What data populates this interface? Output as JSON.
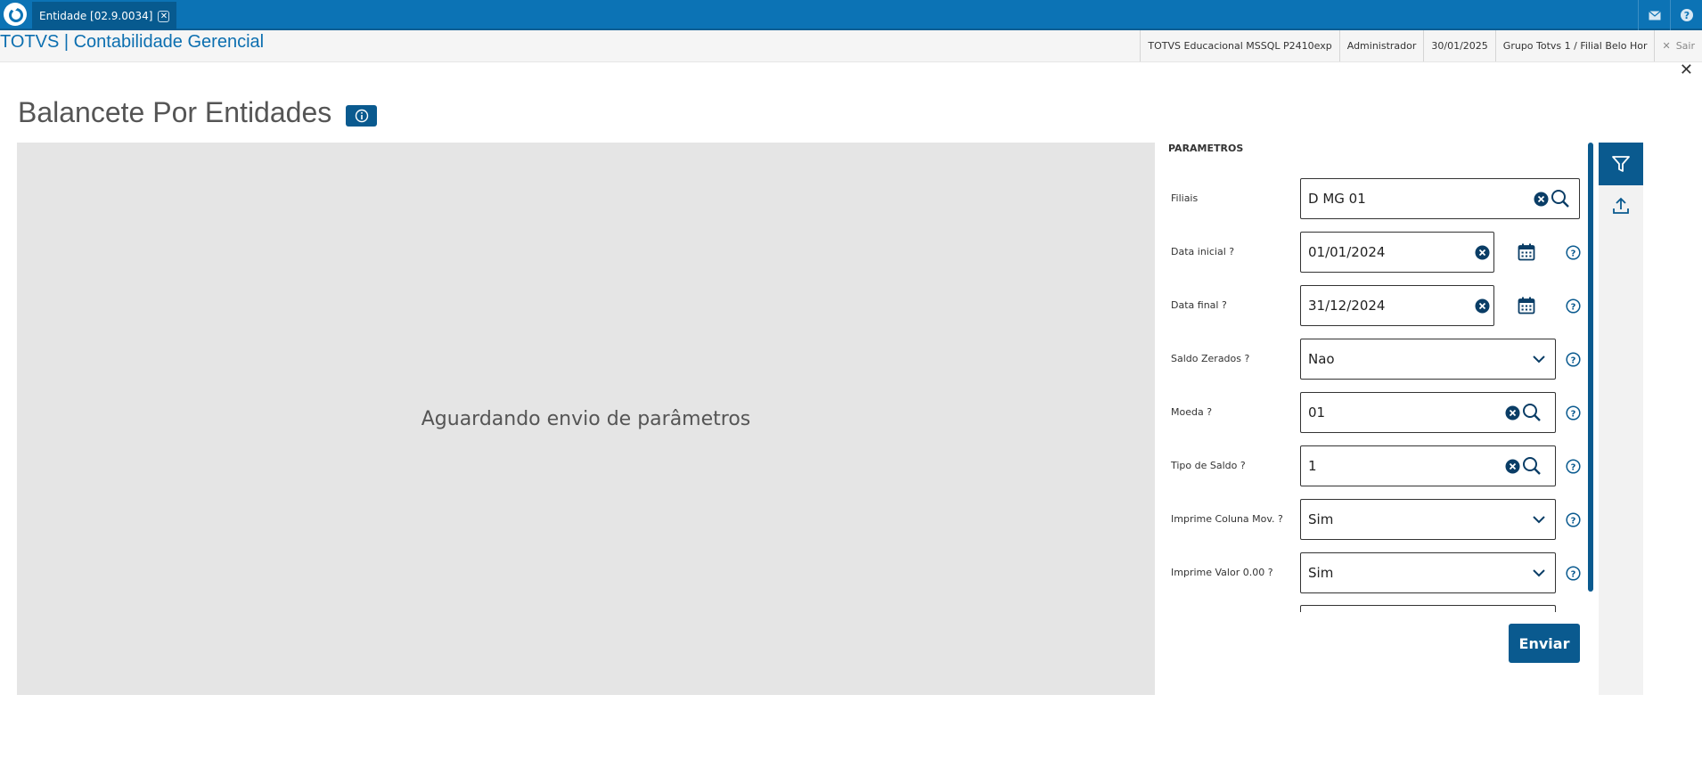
{
  "topbar": {
    "tab_label": "Entidade [02.9.0034]",
    "icons": [
      "mail-icon",
      "help-icon"
    ]
  },
  "header": {
    "app_title": "TOTVS | Contabilidade Gerencial",
    "environment": "TOTVS Educacional MSSQL P2410exp",
    "user": "Administrador",
    "date": "30/01/2025",
    "branch": "Grupo Totvs 1 / Filial Belo Hor",
    "logout_label": "Sair"
  },
  "page": {
    "title": "Balancete Por Entidades",
    "placeholder_message": "Aguardando envio de parâmetros"
  },
  "params": {
    "title": "PARAMETROS",
    "fields": [
      {
        "label": "Filiais",
        "value": "D MG 01"
      },
      {
        "label": "Data inicial ?",
        "value": "01/01/2024"
      },
      {
        "label": "Data final ?",
        "value": "31/12/2024"
      },
      {
        "label": "Saldo Zerados ?",
        "value": "Nao"
      },
      {
        "label": "Moeda ?",
        "value": "01"
      },
      {
        "label": "Tipo de Saldo ?",
        "value": "1"
      },
      {
        "label": "Imprime Coluna Mov. ?",
        "value": "Sim"
      },
      {
        "label": "Imprime Valor 0.00 ?",
        "value": "Sim"
      }
    ],
    "submit_label": "Enviar"
  },
  "colors": {
    "brand": "#0c73b5",
    "accent_dark": "#0a5a8f",
    "preview_bg": "#e5e5e5"
  }
}
